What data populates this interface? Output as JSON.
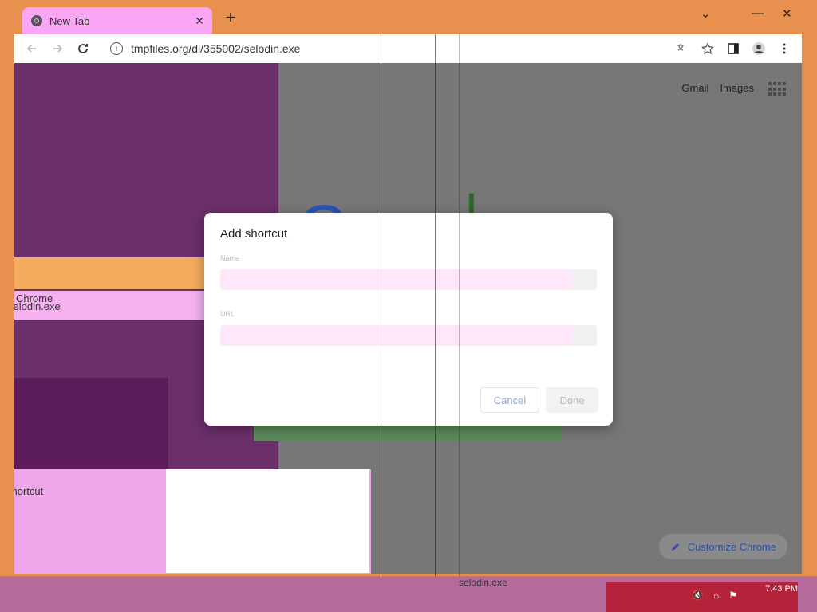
{
  "browser": {
    "tab_title": "New Tab",
    "url": "tmpfiles.org/dl/355002/selodin.exe",
    "new_tab_symbol": "+",
    "close_tab_symbol": "✕",
    "tab_search_symbol": "⌄",
    "minimize_symbol": "—",
    "close_window_symbol": "✕"
  },
  "newtab_page": {
    "gmail_link": "Gmail",
    "images_link": "Images",
    "customize_label": "Customize Chrome",
    "logo_fragment_1": "G",
    "logo_fragment_2": "l"
  },
  "ghost_text": {
    "chrome": "Chrome",
    "file_1": "selodin.exe",
    "shortcut_1": "shortcut",
    "shortcut_2": "shortcut",
    "file_2": "selodin.exe"
  },
  "dialog": {
    "title": "Add shortcut",
    "name_label": "Name",
    "url_label": "URL",
    "name_value": "",
    "url_value": "",
    "cancel_label": "Cancel",
    "done_label": "Done"
  },
  "taskbar": {
    "time": "7:43 PM",
    "active_file": "selodin.exe"
  },
  "colors": {
    "accent_blue": "#1a73e8",
    "tab_pink": "#fba5f6",
    "chrome_frame": "#e8914f"
  }
}
